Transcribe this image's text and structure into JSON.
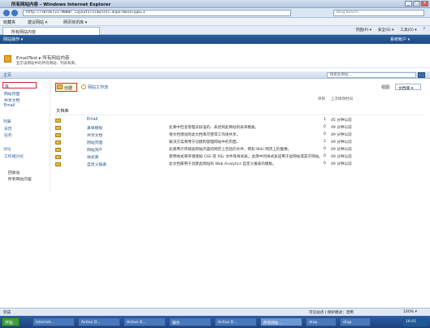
{
  "window": {
    "title": "所有网站内容 - Windows Internet Explorer",
    "min_glyph": "_",
    "max_glyph": "□",
    "close_glyph": "×"
  },
  "address": {
    "url": "http://sbrdsrv1:9000/_layouts/viewlsts.aspx?BaseType=1",
    "search_placeholder": "Bing Search"
  },
  "favorites": {
    "label": "收藏夹",
    "items": [
      "建议网站 ▾",
      "网页快讯库 ▾"
    ]
  },
  "ie_tab": {
    "label": "所有网站内容"
  },
  "ie_commands": [
    "页面(P) ▾",
    "安全(S) ▾",
    "工具(O) ▾",
    "?"
  ],
  "sp_bar": {
    "site_actions": "网站操作 ▾",
    "user": "系统帐户 ▾"
  },
  "header": {
    "breadcrumb": "EmailTest ▸ 所有网站内容",
    "subtitle": "显示该网站中的所有网站、列表和库。"
  },
  "topnav": {
    "home": "主页",
    "search_placeholder": "搜索此网站..."
  },
  "quicklaunch": {
    "libraries_items": [
      "库",
      "网站页面",
      "共享文档",
      "Email"
    ],
    "lists_header": "列表",
    "lists_items": [
      "日历",
      "任务"
    ],
    "discussions_header": "讨论",
    "discussions_items": [
      "工作组讨论"
    ],
    "recycle": "回收站",
    "all_content": "所有网站内容"
  },
  "toolbar": {
    "new_label": "创建",
    "workflow_label": "网站工作流",
    "view_label": "视图:",
    "view_value": "文档库 ▾"
  },
  "columns": {
    "items": "项目",
    "modified": "上次修改时间"
  },
  "section_title": "文档库",
  "rows": [
    {
      "name": "Email",
      "desc": "",
      "count": "1",
      "modified": "45 分钟以前"
    },
    {
      "name": "表单模板",
      "desc": "此库中包含管理员核准的、表述到此网站的表单模板。",
      "count": "0",
      "modified": "49 分钟以前"
    },
    {
      "name": "共享文档",
      "desc": "将文档添加到此文档库可使得工作组共享。",
      "count": "0",
      "modified": "49 分钟以前"
    },
    {
      "name": "网站页面",
      "desc": "解决方案库用于创建和管理网站中的页面。",
      "count": "2",
      "modified": "49 分钟以前"
    },
    {
      "name": "网站资产",
      "desc": "此库用于存储此网站内容的网页上包括的文件，例如 Wiki 网页上的图像。",
      "count": "0",
      "modified": "49 分钟以前"
    },
    {
      "name": "样式库",
      "desc": "使用样式库存储诸如 CSS 或 XSL 文件等样式表。此库中的样式表适用于此网站或其子网站。",
      "count": "0",
      "modified": "49 分钟以前"
    },
    {
      "name": "自定义报表",
      "desc": "此文档库用于创建此网站的 Web Analytics 自定义报表的模板。",
      "count": "0",
      "modified": "49 分钟以前"
    }
  ],
  "status": {
    "left": "完成",
    "zone": "可信站点 | 保护模式：禁用",
    "zoom": "100% ▾"
  },
  "taskbar": {
    "start": "开始",
    "items": [
      "Internet...",
      "Active D...",
      "Active D...",
      "服务",
      "Active D...",
      "所有网站...",
      "drop",
      "drop"
    ],
    "clock": "16:01"
  }
}
